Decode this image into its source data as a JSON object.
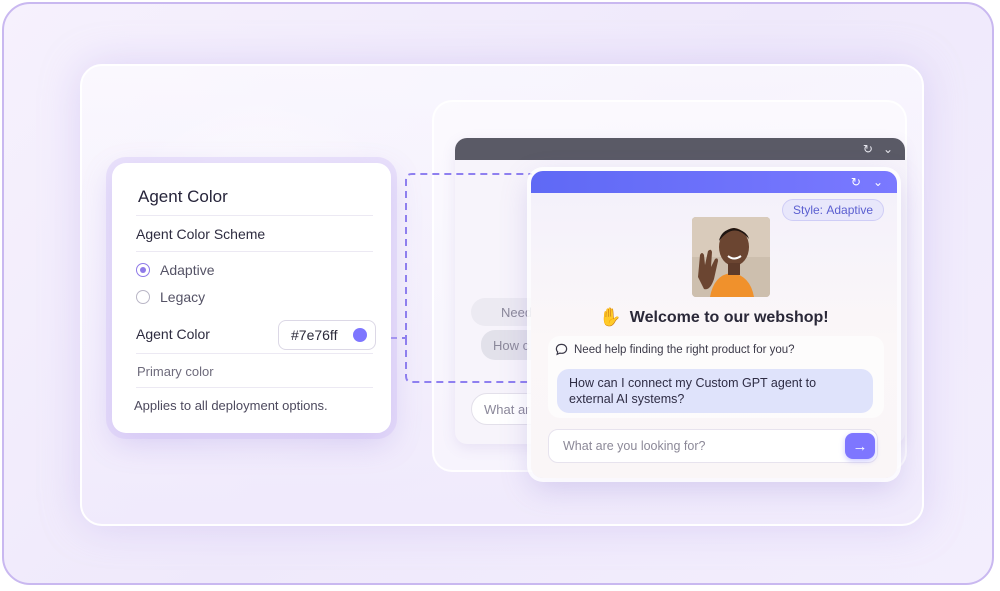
{
  "settings": {
    "title": "Agent Color",
    "scheme_label": "Agent Color Scheme",
    "options": [
      {
        "label": "Adaptive",
        "selected": true
      },
      {
        "label": "Legacy",
        "selected": false
      }
    ],
    "color_label": "Agent Color",
    "color_value": "#7e76ff",
    "primary_label": "Primary color",
    "applies_note": "Applies to all deployment options."
  },
  "back_chat": {
    "bubble_1": "Need",
    "bubble_2": "How c",
    "input_placeholder": "What ar"
  },
  "chat": {
    "style_badge_prefix": "Style: ",
    "style_badge_value": "Adaptive",
    "welcome": "Welcome to our webshop!",
    "help_prompt": "Need help finding the right product for you?",
    "user_message": "How can I connect my Custom GPT agent to external AI systems?",
    "input_placeholder": "What are you looking for?",
    "accent_color": "#7e76ff"
  },
  "icons": [
    "refresh-icon",
    "chevron-down-icon",
    "waving-hand-icon",
    "chat-bubble-icon",
    "arrow-right-icon"
  ]
}
